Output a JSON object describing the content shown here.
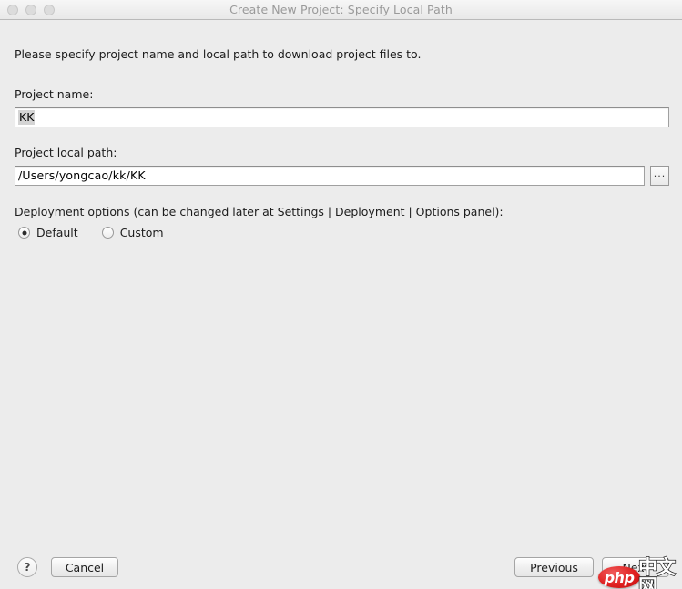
{
  "window": {
    "title": "Create New Project: Specify Local Path",
    "traffic_lights": [
      "close",
      "minimize",
      "zoom"
    ]
  },
  "content": {
    "description": "Please specify project name and local path to download project files to.",
    "project_name": {
      "label": "Project name:",
      "value": "KK",
      "placeholder": ""
    },
    "project_path": {
      "label": "Project local path:",
      "value": "/Users/yongcao/kk/KK",
      "placeholder": "",
      "browse_label": "..."
    },
    "deployment": {
      "label": "Deployment options (can be changed later at Settings | Deployment | Options panel):",
      "options": [
        {
          "label": "Default",
          "selected": true
        },
        {
          "label": "Custom",
          "selected": false
        }
      ]
    }
  },
  "footer": {
    "help_label": "?",
    "cancel_label": "Cancel",
    "previous_label": "Previous",
    "next_label": "Next"
  },
  "watermark": {
    "badge_text": "php",
    "suffix_text": "中文网",
    "badge_color": "#e02020"
  }
}
